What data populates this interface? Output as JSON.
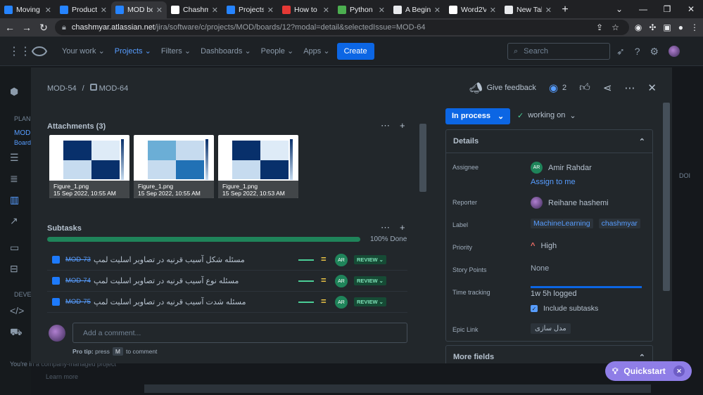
{
  "browser": {
    "tabs": [
      {
        "label": "Moving",
        "color": "#2684ff",
        "active": false
      },
      {
        "label": "Product",
        "color": "#2684ff",
        "active": false
      },
      {
        "label": "MOD bo",
        "color": "#2684ff",
        "active": true
      },
      {
        "label": "Chashm",
        "color": "#ffffff",
        "active": false
      },
      {
        "label": "Projects",
        "color": "#2684ff",
        "active": false
      },
      {
        "label": "How to",
        "color": "#e53935",
        "active": false
      },
      {
        "label": "Python",
        "color": "#4caf50",
        "active": false
      },
      {
        "label": "A Begin",
        "color": "#e8eaed",
        "active": false
      },
      {
        "label": "Word2V",
        "color": "#ffffff",
        "active": false
      },
      {
        "label": "New Tab",
        "color": "#e8eaed",
        "active": false
      }
    ],
    "url_host": "chashmyar.atlassian.net",
    "url_path": "/jira/software/c/projects/MOD/boards/12?modal=detail&selectedIssue=MOD-64"
  },
  "nav": {
    "menu": [
      "Your work",
      "Projects",
      "Filters",
      "Dashboards",
      "People",
      "Apps"
    ],
    "create": "Create",
    "search_placeholder": "Search"
  },
  "sidebar": {
    "section_planning": "PLANI",
    "project_short": "MOD",
    "board_short": "Board",
    "section_dev": "DEVEL",
    "footer_text": "You're in a company-managed project",
    "learn_more": "Learn more",
    "right_peek": "DOI"
  },
  "issue": {
    "parent_key": "MOD-54",
    "key": "MOD-64",
    "give_feedback": "Give feedback",
    "watchers": "2",
    "attachments_title": "Attachments (3)",
    "attachments": [
      {
        "name": "Figure_1.png",
        "date": "15 Sep 2022, 10:55 AM"
      },
      {
        "name": "Figure_1.png",
        "date": "15 Sep 2022, 10:55 AM"
      },
      {
        "name": "Figure_1.png",
        "date": "15 Sep 2022, 10:53 AM"
      }
    ],
    "subtasks_title": "Subtasks",
    "subtasks_done": 1.0,
    "subtasks_done_label": "100% Done",
    "subtasks": [
      {
        "key": "MOD-73",
        "summary": "مسئله شکل آسیب قرنیه در تصاویر اسلیت لمپ",
        "assignee": "AR",
        "status": "REVIEW"
      },
      {
        "key": "MOD-74",
        "summary": "مسئله نوع آسیب قرنیه در تصاویر اسلیت لمپ",
        "assignee": "AR",
        "status": "REVIEW"
      },
      {
        "key": "MOD-75",
        "summary": "مسئله شدت آسیب قرنیه در تصاویر اسلیت لمپ",
        "assignee": "AR",
        "status": "REVIEW"
      }
    ],
    "comment_placeholder": "Add a comment...",
    "protip_prefix": "Pro tip:",
    "protip_press": "press",
    "protip_key": "M",
    "protip_suffix": "to comment"
  },
  "details": {
    "status": "In process",
    "transition": "working on",
    "title": "Details",
    "assignee_label": "Assignee",
    "assignee": "Amir Rahdar",
    "assignee_initials": "AR",
    "assign_to_me": "Assign to me",
    "reporter_label": "Reporter",
    "reporter": "Reihane hashemi",
    "label_label": "Label",
    "labels": [
      "MachineLearning",
      "chashmyar"
    ],
    "priority_label": "Priority",
    "priority": "High",
    "story_points_label": "Story Points",
    "story_points": "None",
    "time_tracking_label": "Time tracking",
    "time_logged": "1w 5h logged",
    "include_subtasks": "Include subtasks",
    "epic_label": "Epic Link",
    "epic": "مدل سازی",
    "more_fields": "More fields"
  },
  "quickstart": "Quickstart"
}
